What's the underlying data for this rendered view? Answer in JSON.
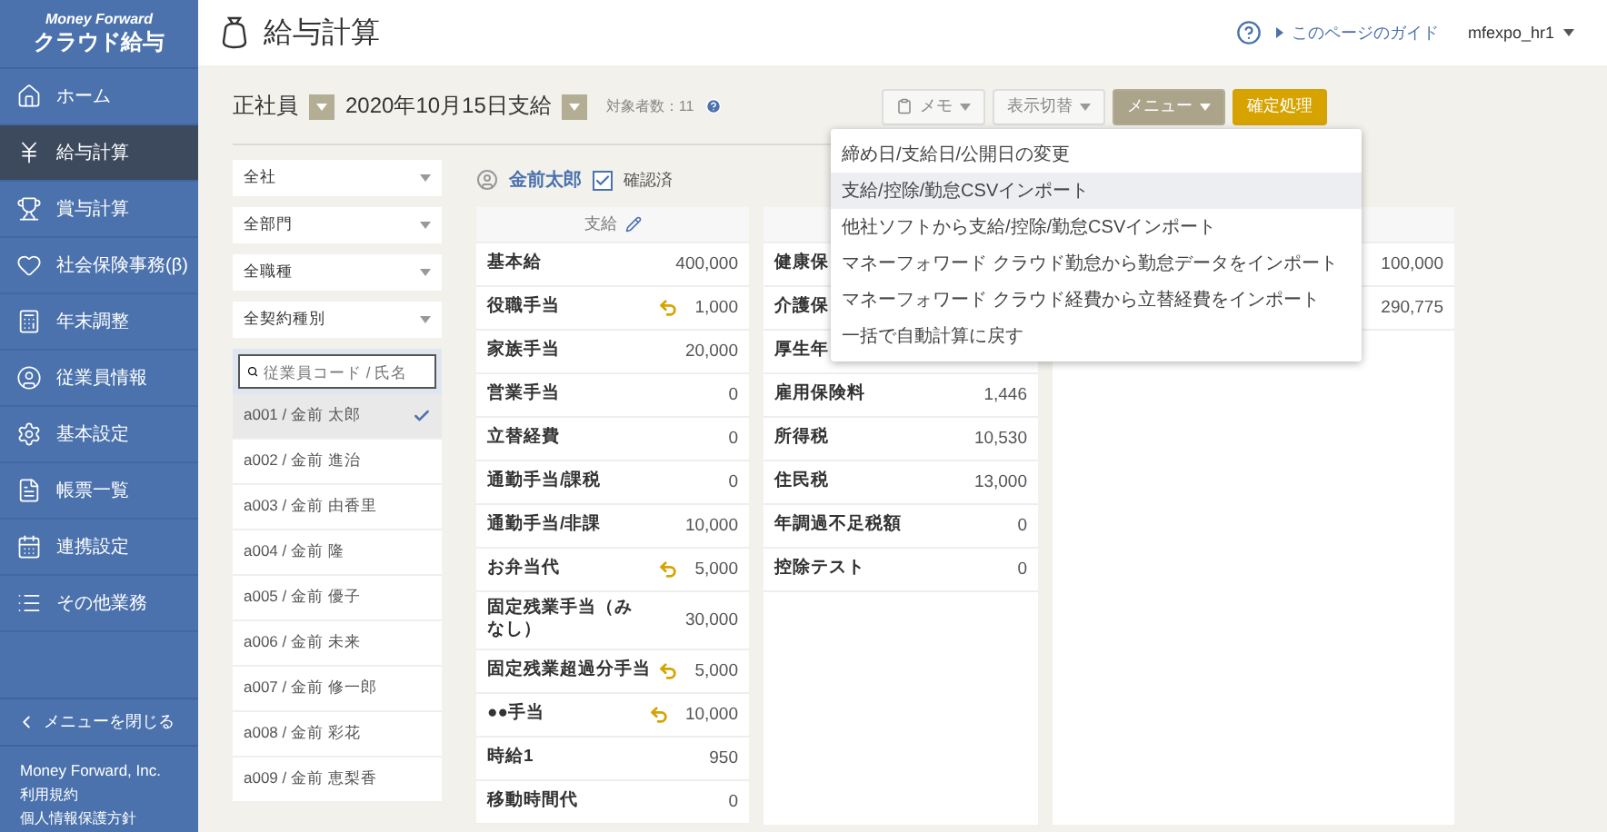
{
  "sidebar": {
    "brand": "Money Forward",
    "product": "クラウド給与",
    "items": [
      {
        "label": "ホーム",
        "kind": "home",
        "selected": false
      },
      {
        "label": "給与計算",
        "kind": "payroll",
        "selected": true
      },
      {
        "label": "賞与計算",
        "kind": "bonus",
        "selected": false
      },
      {
        "label": "社会保険事務(β)",
        "kind": "insurance",
        "selected": false
      },
      {
        "label": "年末調整",
        "kind": "yearend",
        "selected": false
      },
      {
        "label": "従業員情報",
        "kind": "staff",
        "selected": false
      },
      {
        "label": "基本設定",
        "kind": "settings",
        "selected": false
      },
      {
        "label": "帳票一覧",
        "kind": "reports",
        "selected": false
      },
      {
        "label": "連携設定",
        "kind": "integration",
        "selected": false
      },
      {
        "label": "その他業務",
        "kind": "other",
        "selected": false
      }
    ],
    "collapse": "メニューを閉じる",
    "company": "Money Forward, Inc.",
    "links": [
      "利用規約",
      "個人情報保護方針"
    ]
  },
  "header": {
    "title": "給与計算",
    "guide": "このページのガイド",
    "user": "mfexpo_hr1"
  },
  "toolbar": {
    "employment_type": "正社員",
    "pay_date": "2020年10月15日支給",
    "target_count": "対象者数：11",
    "buttons": [
      {
        "label": "メモ",
        "kind": "memo"
      },
      {
        "label": "表示切替",
        "kind": "plain"
      },
      {
        "label": "メニュー",
        "kind": "menu"
      },
      {
        "label": "確定処理",
        "kind": "primary"
      }
    ]
  },
  "filters": [
    "全社",
    "全部門",
    "全職種",
    "全契約種別"
  ],
  "search": {
    "placeholder": "従業員コード / 氏名"
  },
  "employees": [
    {
      "label": "a001 / 金前 太郎",
      "selected": true
    },
    {
      "label": "a002 / 金前 進治",
      "selected": false
    },
    {
      "label": "a003 / 金前 由香里",
      "selected": false
    },
    {
      "label": "a004 / 金前 隆",
      "selected": false
    },
    {
      "label": "a005 / 金前 優子",
      "selected": false
    },
    {
      "label": "a006 / 金前 未来",
      "selected": false
    },
    {
      "label": "a007 / 金前 修一郎",
      "selected": false
    },
    {
      "label": "a008 / 金前 彩花",
      "selected": false
    },
    {
      "label": "a009 / 金前 恵梨香",
      "selected": false
    }
  ],
  "employee": {
    "name": "金前太郎",
    "confirmed": {
      "label": "確認済",
      "checked": true
    }
  },
  "payments": {
    "title": "支給",
    "rows": [
      {
        "label": "基本給",
        "value": "400,000",
        "overridden": false
      },
      {
        "label": "役職手当",
        "value": "1,000",
        "overridden": true
      },
      {
        "label": "家族手当",
        "value": "20,000",
        "overridden": false
      },
      {
        "label": "営業手当",
        "value": "0",
        "overridden": false
      },
      {
        "label": "立替経費",
        "value": "0",
        "overridden": false
      },
      {
        "label": "通勤手当/課税",
        "value": "0",
        "overridden": false
      },
      {
        "label": "通勤手当/非課",
        "value": "10,000",
        "overridden": false
      },
      {
        "label": "お弁当代",
        "value": "5,000",
        "overridden": true
      },
      {
        "label": "固定残業手当（みなし）",
        "value": "30,000",
        "overridden": false
      },
      {
        "label": "固定残業超過分手当",
        "value": "5,000",
        "overridden": true
      },
      {
        "label": "●●手当",
        "value": "10,000",
        "overridden": true
      },
      {
        "label": "時給1",
        "value": "950",
        "overridden": false
      },
      {
        "label": "移動時間代",
        "value": "0",
        "overridden": false
      }
    ]
  },
  "deductions": {
    "rows": [
      {
        "label": "健康保"
      },
      {
        "label": "介護保"
      },
      {
        "label": "厚生年"
      },
      {
        "label": "雇用保険料",
        "value": "1,446"
      },
      {
        "label": "所得税",
        "value": "10,530"
      },
      {
        "label": "住民税",
        "value": "13,000"
      },
      {
        "label": "年調過不足税額",
        "value": "0"
      },
      {
        "label": "控除テスト",
        "value": "0"
      }
    ]
  },
  "totals": {
    "rows": [
      {
        "value": "100,000"
      },
      {
        "value": "290,775"
      }
    ]
  },
  "menu": {
    "items": [
      {
        "label": "締め日/支給日/公開日の変更",
        "highlighted": false
      },
      {
        "label": "支給/控除/勤怠CSVインポート",
        "highlighted": true
      },
      {
        "label": "他社ソフトから支給/控除/勤怠CSVインポート",
        "highlighted": false
      },
      {
        "label": "マネーフォワード クラウド勤怠から勤怠データをインポート",
        "highlighted": false
      },
      {
        "label": "マネーフォワード クラウド経費から立替経費をインポート",
        "highlighted": false
      },
      {
        "label": "一括で自動計算に戻す",
        "highlighted": false
      }
    ]
  }
}
